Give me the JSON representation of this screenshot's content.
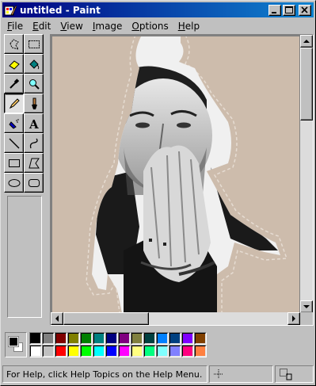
{
  "window": {
    "title": "untitled - Paint",
    "app_icon": "paint-app-icon"
  },
  "menu": [
    {
      "label": "File",
      "key": "F",
      "rest": "ile"
    },
    {
      "label": "Edit",
      "key": "E",
      "rest": "dit"
    },
    {
      "label": "View",
      "key": "V",
      "rest": "iew"
    },
    {
      "label": "Image",
      "key": "I",
      "rest": "mage"
    },
    {
      "label": "Options",
      "key": "O",
      "rest": "ptions"
    },
    {
      "label": "Help",
      "key": "H",
      "rest": "elp"
    }
  ],
  "tools": [
    {
      "name": "free-form-select-icon",
      "active": false
    },
    {
      "name": "rect-select-icon",
      "active": false
    },
    {
      "name": "eraser-icon",
      "active": false
    },
    {
      "name": "fill-bucket-icon",
      "active": false
    },
    {
      "name": "color-picker-icon",
      "active": false
    },
    {
      "name": "magnifier-icon",
      "active": false
    },
    {
      "name": "pencil-icon",
      "active": true
    },
    {
      "name": "brush-icon",
      "active": false
    },
    {
      "name": "airbrush-icon",
      "active": false
    },
    {
      "name": "text-icon",
      "active": false
    },
    {
      "name": "line-icon",
      "active": false
    },
    {
      "name": "curve-icon",
      "active": false
    },
    {
      "name": "rectangle-icon",
      "active": false
    },
    {
      "name": "polygon-icon",
      "active": false
    },
    {
      "name": "ellipse-icon",
      "active": false
    },
    {
      "name": "rounded-rect-icon",
      "active": false
    }
  ],
  "colors": {
    "foreground": "#000000",
    "background": "#ffffff",
    "canvas_bg": "#cdbcac",
    "palette_row1": [
      "#000000",
      "#808080",
      "#800000",
      "#808000",
      "#008000",
      "#008080",
      "#000080",
      "#800080",
      "#808040",
      "#004040",
      "#0080ff",
      "#004080",
      "#8000ff",
      "#804000"
    ],
    "palette_row2": [
      "#ffffff",
      "#c0c0c0",
      "#ff0000",
      "#ffff00",
      "#00ff00",
      "#00ffff",
      "#0000ff",
      "#ff00ff",
      "#ffff80",
      "#00ff80",
      "#80ffff",
      "#8080ff",
      "#ff0080",
      "#ff8040"
    ]
  },
  "status": {
    "help_text": "For Help, click Help Topics on the Help Menu."
  }
}
